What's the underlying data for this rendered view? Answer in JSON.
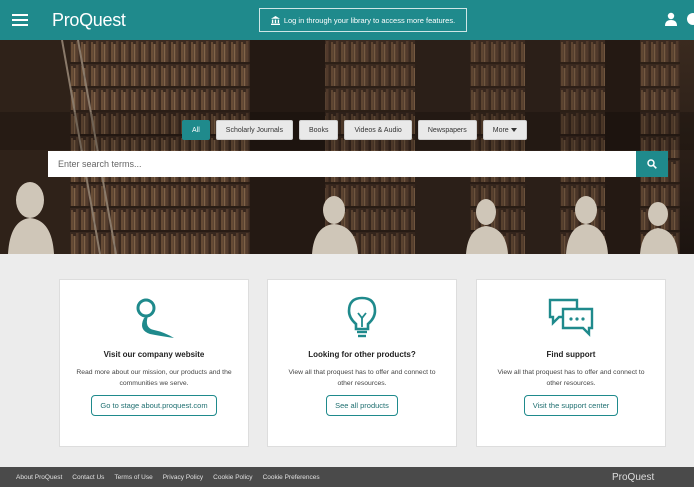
{
  "header": {
    "brand": "ProQuest",
    "login_label": "Log in through your library to access more features.",
    "menu_icon": "hamburger-menu-icon",
    "user_icon": "user-icon",
    "language_icon": "globe-icon"
  },
  "search": {
    "tabs": [
      {
        "label": "All",
        "active": true
      },
      {
        "label": "Scholarly Journals",
        "active": false
      },
      {
        "label": "Books",
        "active": false
      },
      {
        "label": "Videos & Audio",
        "active": false
      },
      {
        "label": "Newspapers",
        "active": false
      },
      {
        "label": "More",
        "active": false
      }
    ],
    "placeholder": "Enter search terms...",
    "search_icon": "search-icon"
  },
  "cards": [
    {
      "title": "Visit our company website",
      "description": "Read more about our mission, our products and the communities we serve.",
      "button": "Go to stage about.proquest.com",
      "icon": "proquest-logo-icon"
    },
    {
      "title": "Looking for other products?",
      "description": "View all that proquest has to offer and connect to other resources.",
      "button": "See all products",
      "icon": "lightbulb-icon"
    },
    {
      "title": "Find support",
      "description": "View all that proquest has to offer and connect to other resources.",
      "button": "Visit the support center",
      "icon": "chat-bubbles-icon"
    }
  ],
  "footer": {
    "links": [
      "About ProQuest",
      "Contact Us",
      "Terms of Use",
      "Privacy Policy",
      "Cookie Policy",
      "Cookie Preferences"
    ],
    "logo": "ProQuest"
  },
  "colors": {
    "accent": "#1f8a8c",
    "footer": "#4a4a4a"
  }
}
